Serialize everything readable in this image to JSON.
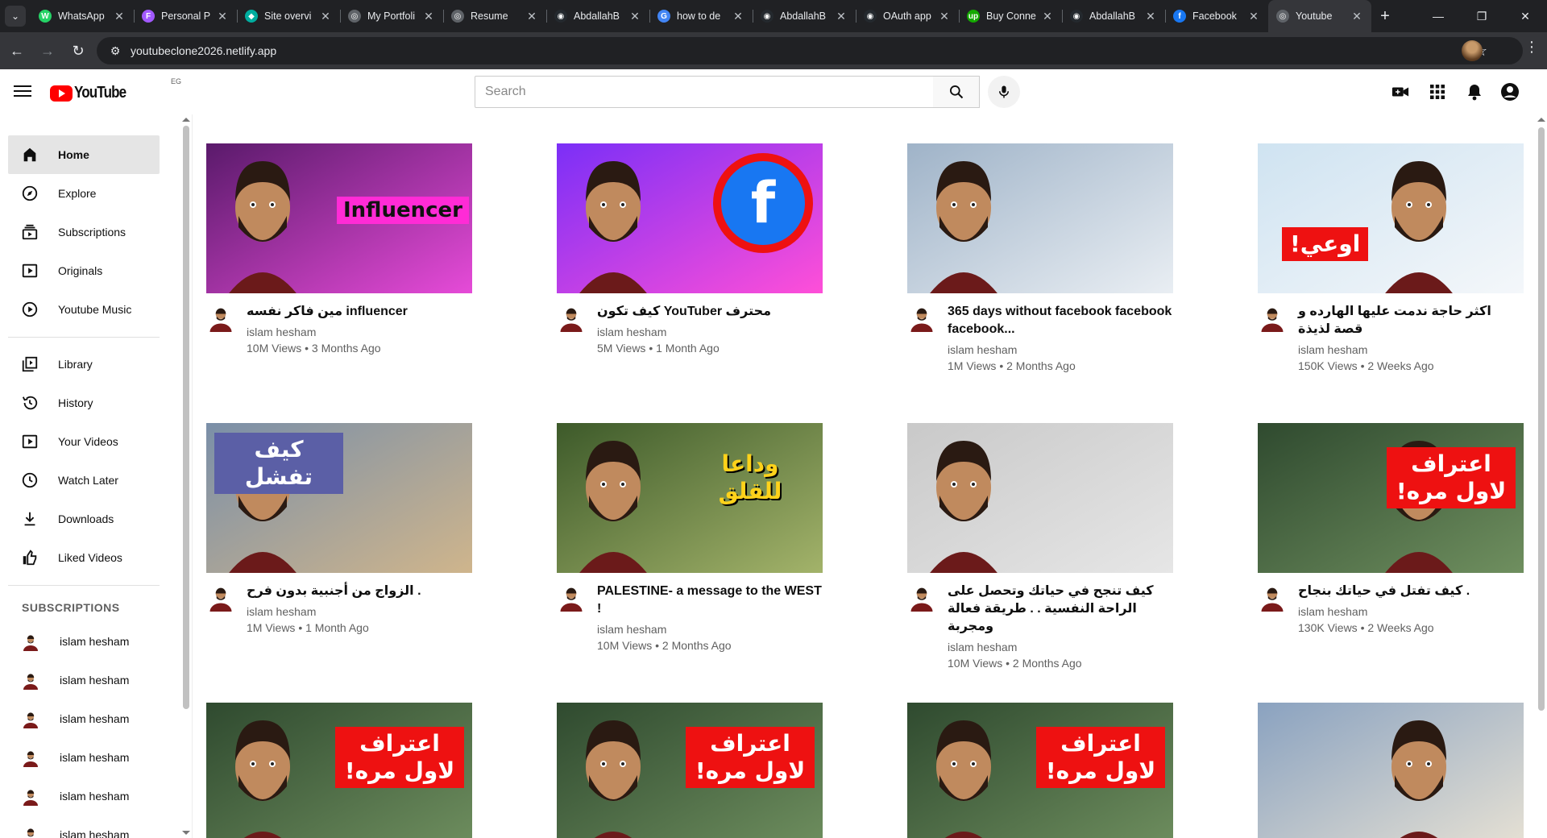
{
  "browser": {
    "tabs": [
      {
        "title": "WhatsApp",
        "color": "#25D366",
        "glyph": "W"
      },
      {
        "title": "Personal P",
        "color": "#a259ff",
        "glyph": "F"
      },
      {
        "title": "Site overvi",
        "color": "#00ad9f",
        "glyph": "◆"
      },
      {
        "title": "My Portfoli",
        "color": "#5f6368",
        "glyph": "◎"
      },
      {
        "title": "Resume",
        "color": "#5f6368",
        "glyph": "◎"
      },
      {
        "title": "AbdallahB",
        "color": "#24292e",
        "glyph": "◉"
      },
      {
        "title": "how to de",
        "color": "#4285F4",
        "glyph": "G"
      },
      {
        "title": "AbdallahB",
        "color": "#24292e",
        "glyph": "◉"
      },
      {
        "title": "OAuth app",
        "color": "#24292e",
        "glyph": "◉"
      },
      {
        "title": "Buy Conne",
        "color": "#14a800",
        "glyph": "up"
      },
      {
        "title": "AbdallahB",
        "color": "#24292e",
        "glyph": "◉"
      },
      {
        "title": "Facebook",
        "color": "#1877F2",
        "glyph": "f"
      },
      {
        "title": "Youtube",
        "color": "#5f6368",
        "glyph": "◎"
      }
    ],
    "url": "youtubeclone2026.netlify.app"
  },
  "header": {
    "logo_text": "YouTube",
    "country_code": "EG",
    "search_placeholder": "Search"
  },
  "sidebar": {
    "main": [
      {
        "label": "Home",
        "icon": "home-icon"
      },
      {
        "label": "Explore",
        "icon": "explore-icon"
      },
      {
        "label": "Subscriptions",
        "icon": "subscriptions-icon"
      },
      {
        "label": "Originals",
        "icon": "originals-icon"
      },
      {
        "label": "Youtube Music",
        "icon": "music-icon"
      }
    ],
    "library": [
      {
        "label": "Library",
        "icon": "library-icon"
      },
      {
        "label": "History",
        "icon": "history-icon"
      },
      {
        "label": "Your Videos",
        "icon": "your-videos-icon"
      },
      {
        "label": "Watch Later",
        "icon": "watch-later-icon"
      },
      {
        "label": "Downloads",
        "icon": "downloads-icon"
      },
      {
        "label": "Liked Videos",
        "icon": "liked-videos-icon"
      }
    ],
    "subscriptions_heading": "SUBSCRIPTIONS",
    "subscriptions": [
      "islam hesham",
      "islam hesham",
      "islam hesham",
      "islam hesham",
      "islam hesham",
      "islam hesham"
    ]
  },
  "videos": [
    {
      "title": "مين فاكر نفسه influencer",
      "channel": "islam hesham",
      "stats": "10M Views • 3 Months Ago",
      "overlay": "Influencer",
      "bg": [
        "#5a1a6b",
        "#e64bd8"
      ]
    },
    {
      "title": "كيف تكون YouTuber محترف",
      "channel": "islam hesham",
      "stats": "5M Views • 1 Month Ago",
      "overlay": "f",
      "bg": [
        "#7b2ff7",
        "#ff4fd8"
      ]
    },
    {
      "title": "365 days without facebook facebook facebook...",
      "channel": "islam hesham",
      "stats": "1M Views • 2 Months Ago",
      "overlay": "",
      "bg": [
        "#9fb3c8",
        "#e9eef3"
      ]
    },
    {
      "title": "اكثر حاجة ندمت عليها الهارده و قصة لذيذة",
      "channel": "islam hesham",
      "stats": "150K Views • 2 Weeks Ago",
      "overlay": "اوعي!",
      "bg": [
        "#cfe3f1",
        "#f4f7fa"
      ]
    },
    {
      "title": "الزواج من أجنبية بدون فرح .",
      "channel": "islam hesham",
      "stats": "1M Views • 1 Month Ago",
      "overlay": "كيف تفشل",
      "bg": [
        "#7a8fa8",
        "#cfb58c"
      ]
    },
    {
      "title": "PALESTINE- a message to the WEST !",
      "channel": "islam hesham",
      "stats": "10M Views • 2 Months Ago",
      "overlay": "وداعا للقلق",
      "bg": [
        "#3d5a2a",
        "#a3b36a"
      ]
    },
    {
      "title": "كيف تنجح في حياتك وتحصل على الراحة النفسية . . طريقة فعالة ومجربة",
      "channel": "islam hesham",
      "stats": "10M Views • 2 Months Ago",
      "overlay": "",
      "bg": [
        "#c9c9c9",
        "#e6e6e6"
      ]
    },
    {
      "title": "كيف تفتل في حياتك بنجاح .",
      "channel": "islam hesham",
      "stats": "130K Views • 2 Weeks Ago",
      "overlay": "اعتراف لاول مره!",
      "bg": [
        "#2f4a2f",
        "#6f8f5f"
      ]
    },
    {
      "title": "",
      "channel": "",
      "stats": "",
      "overlay": "اعتراف لاول مره!",
      "bg": [
        "#2f4a2f",
        "#6f8f5f"
      ]
    },
    {
      "title": "",
      "channel": "",
      "stats": "",
      "overlay": "اعتراف لاول مره!",
      "bg": [
        "#2f4a2f",
        "#6f8f5f"
      ]
    },
    {
      "title": "",
      "channel": "",
      "stats": "",
      "overlay": "اعتراف لاول مره!",
      "bg": [
        "#2f4a2f",
        "#6f8f5f"
      ]
    },
    {
      "title": "",
      "channel": "",
      "stats": "",
      "overlay": "",
      "bg": [
        "#8aa2c0",
        "#e8e2d4"
      ]
    }
  ]
}
